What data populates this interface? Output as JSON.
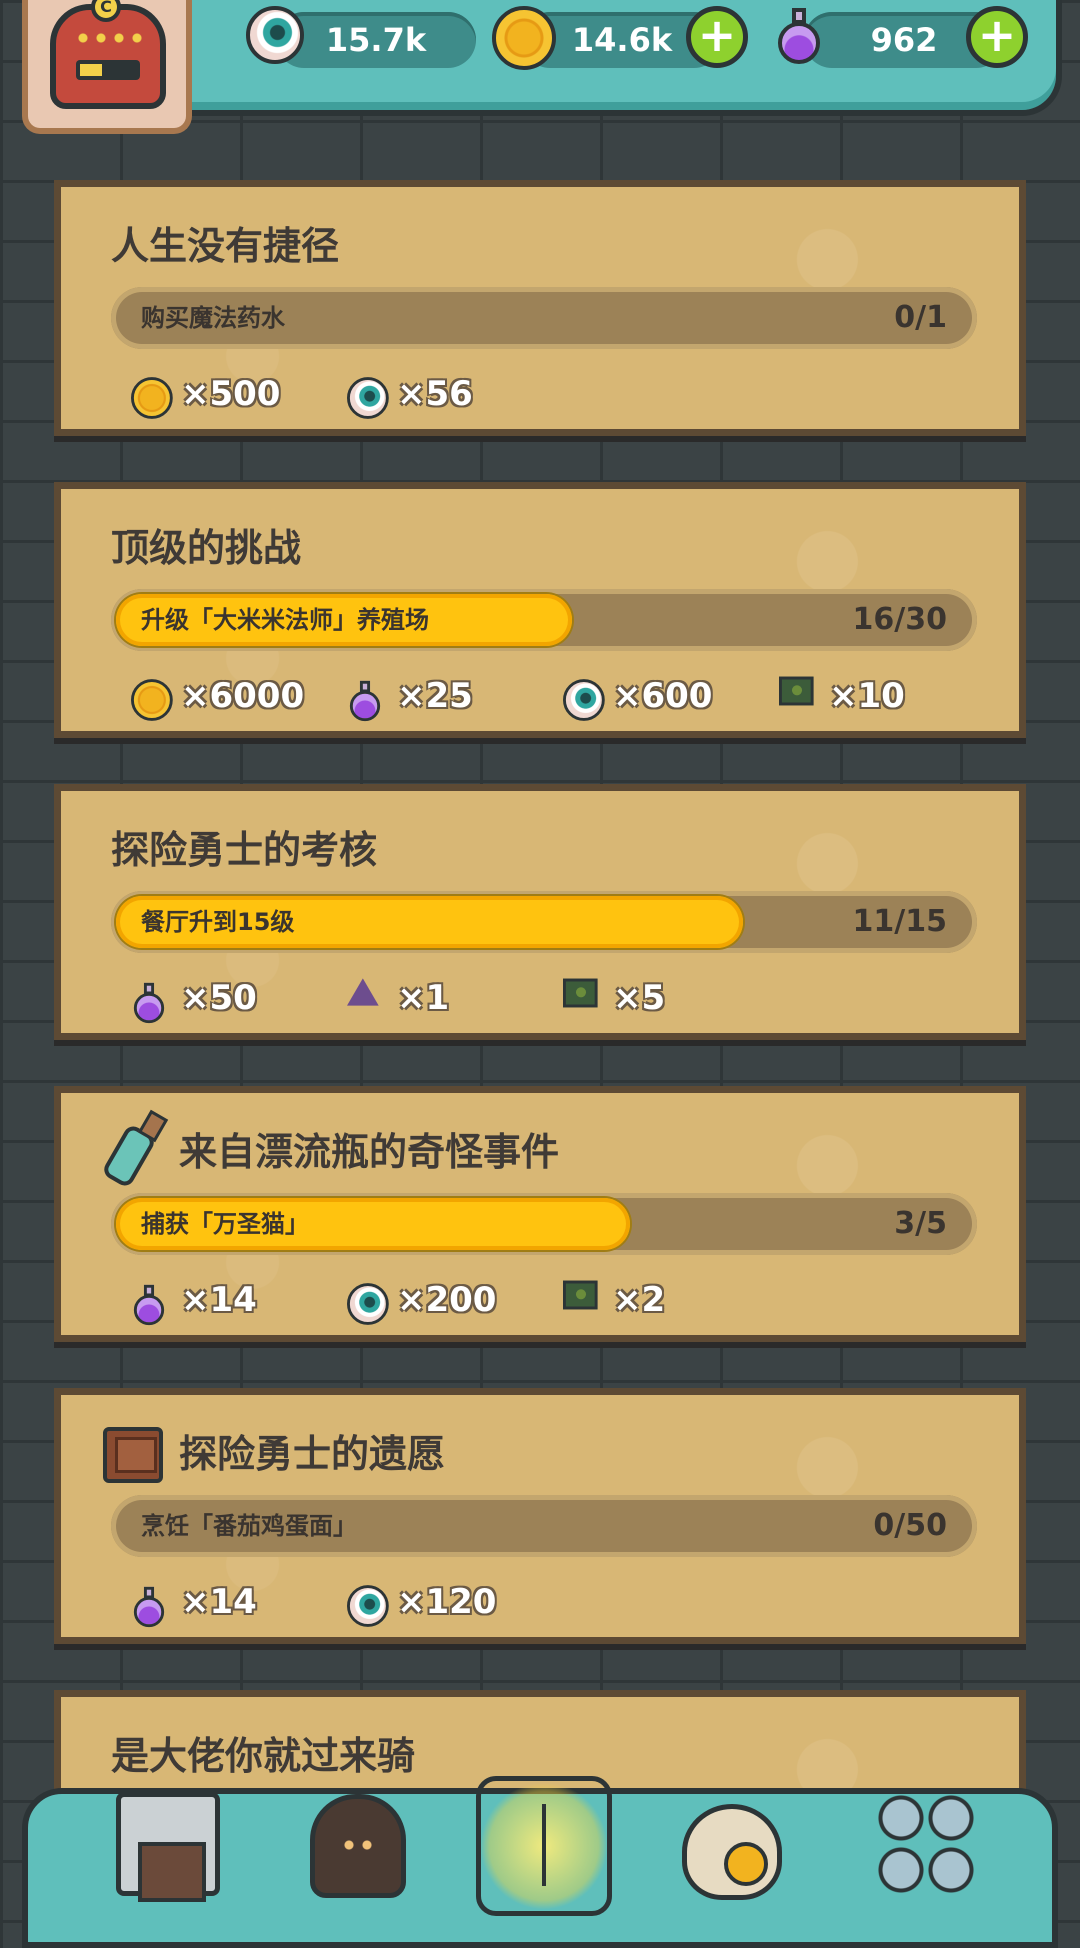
{
  "resources": [
    {
      "name": "eyeballs",
      "value": "15.7k",
      "icon": "eye-icon"
    },
    {
      "name": "coins",
      "value": "14.6k",
      "icon": "coin-icon",
      "has_plus": true
    },
    {
      "name": "potions",
      "value": "962",
      "icon": "potion-icon",
      "has_plus": true
    }
  ],
  "plus_label": "+",
  "avatar": {
    "crest_letter": "C"
  },
  "quests": [
    {
      "title": "人生没有捷径",
      "task": "购买魔法药水",
      "progress_text": "0/1",
      "progress": 0.0,
      "title_icon": "",
      "rewards": [
        {
          "icon": "coin-icon",
          "amount": "×500"
        },
        {
          "icon": "eye-icon",
          "amount": "×56"
        }
      ]
    },
    {
      "title": "顶级的挑战",
      "task": "升级「大米米法师」养殖场",
      "progress_text": "16/30",
      "progress": 0.533,
      "title_icon": "",
      "rewards": [
        {
          "icon": "coin-icon",
          "amount": "×6000"
        },
        {
          "icon": "potion-icon",
          "amount": "×25"
        },
        {
          "icon": "eye-icon",
          "amount": "×600"
        },
        {
          "icon": "map-icon",
          "amount": "×10"
        }
      ]
    },
    {
      "title": "探险勇士的考核",
      "task": "餐厅升到15级",
      "progress_text": "11/15",
      "progress": 0.733,
      "title_icon": "",
      "rewards": [
        {
          "icon": "potion-icon",
          "amount": "×50"
        },
        {
          "icon": "tri-icon",
          "amount": "×1"
        },
        {
          "icon": "map-icon",
          "amount": "×5"
        }
      ]
    },
    {
      "title": "来自漂流瓶的奇怪事件",
      "task": "捕获「万圣猫」",
      "progress_text": "3/5",
      "progress": 0.6,
      "title_icon": "bottle-icon",
      "rewards": [
        {
          "icon": "potion-icon",
          "amount": "×14"
        },
        {
          "icon": "eye-icon",
          "amount": "×200"
        },
        {
          "icon": "map-icon",
          "amount": "×2"
        }
      ]
    },
    {
      "title": "探险勇士的遗愿",
      "task": "烹饪「番茄鸡蛋面」",
      "progress_text": "0/50",
      "progress": 0.0,
      "title_icon": "book-icon",
      "rewards": [
        {
          "icon": "potion-icon",
          "amount": "×14"
        },
        {
          "icon": "eye-icon",
          "amount": "×120"
        }
      ]
    },
    {
      "title": "是大佬你就过来骑",
      "task": "",
      "progress_text": "",
      "progress": 0.0,
      "title_icon": "",
      "rewards": []
    }
  ],
  "bottom_nav": [
    {
      "icon": "shop-icon",
      "active": false
    },
    {
      "icon": "beast-icon",
      "active": false
    },
    {
      "icon": "book-nav-icon",
      "active": true
    },
    {
      "icon": "bag-icon",
      "active": false
    },
    {
      "icon": "grid-icon",
      "active": false
    }
  ],
  "colors": {
    "accent": "#5fbfbb",
    "card": "#d8b775",
    "progress_fill": "#ffc30f",
    "plus_button": "#8ed12e"
  }
}
